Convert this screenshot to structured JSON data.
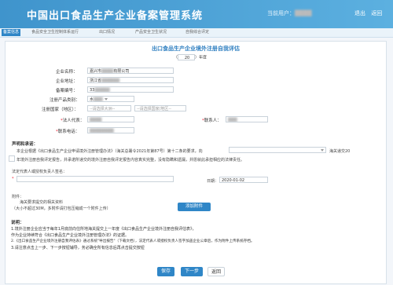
{
  "header": {
    "title": "中国出口食品生产企业备案管理系统",
    "user_label": "当前用户：",
    "links": [
      "退出",
      "返回"
    ]
  },
  "nav": {
    "items": [
      "备案信息",
      "食品安全卫生控制体系运行",
      "出口情况",
      "产品安全卫生状况",
      "自我综合评定"
    ]
  },
  "form": {
    "title": "出口食品生产企业境外注册自我评估",
    "year_open": "（",
    "year_value": "20",
    "year_close": "）年度",
    "fields": {
      "company_name": {
        "label": "企业名称：",
        "value": "嘉兴市",
        "value_tail": "有限公司"
      },
      "company_addr": {
        "label": "企业地址：",
        "value": "浙江省"
      },
      "record_no": {
        "label": "备案编号：",
        "value": "33"
      },
      "product_cat": {
        "label": "注册产品类别：",
        "value": "水"
      },
      "country": {
        "label": "注册国家（地区）：",
        "placeholder1": "--请选择大洲--",
        "placeholder2": "--请选择国家/地区--"
      },
      "legal_rep": {
        "label": "法人代表："
      },
      "contact": {
        "label": "联系人："
      },
      "phone": {
        "label": "联系电话："
      }
    },
    "declaration": {
      "heading": "声明和承诺：",
      "line1": "本企业根据《出口食品生产企业申请境外注册管理办法》（海关总署令2021年第87号）第十二条的要求，向",
      "line1_end": "海关递交20",
      "line2": "年境外注册自我评定报告，并承诺所递交的境外注册自我评定报告内容真实完整，没有隐瞒和遗漏，并愿就此承担相应的法律责任。",
      "sign_label": "法定代表人或授权负责人签名：",
      "date_label": "日期：",
      "date_value": "2020-01-02"
    },
    "attachment": {
      "label": "附件：",
      "placeholder": "海关要求提交的相关资料",
      "hint": "（大小不超过30M，多附件请打包压缩成一个附件上传）",
      "upload_button": "添加附件"
    },
    "notes": {
      "title": "说明：",
      "lines": [
        "1.境外注册企业应当于每年1月底前向住所地海关提交上一年度《出口食品生产企业境外注册自我评估表》，",
        "作为企业持续符合《出口食品生产企业境外注册管理办法》的证据。",
        "2.《出口食品生产企业境外注册自我评估表》通过系统\"导出报告\"（下载文档），法定代表人或授权负责人签字加盖企业公章后，作为附件上传系统存档。",
        "3.请注意点击上一步、下一步按钮辅导，务必确全所有信息后再点击提交按钮"
      ]
    },
    "buttons": {
      "save": "保存",
      "next": "下一步",
      "back": "返回"
    }
  }
}
